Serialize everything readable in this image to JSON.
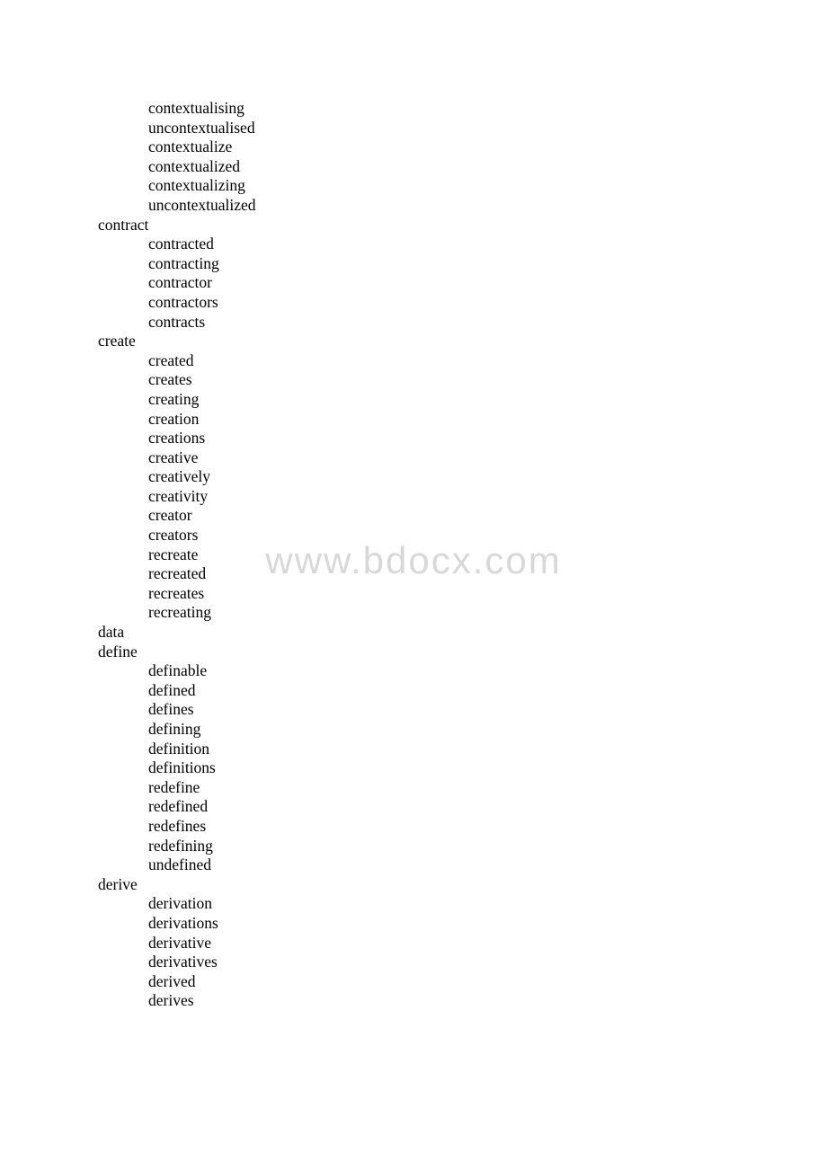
{
  "watermark": "www.bdocx.com",
  "document": {
    "lines": [
      {
        "text": "contextualising",
        "level": 1
      },
      {
        "text": "uncontextualised",
        "level": 1
      },
      {
        "text": "contextualize",
        "level": 1
      },
      {
        "text": "contextualized",
        "level": 1
      },
      {
        "text": "contextualizing",
        "level": 1
      },
      {
        "text": "uncontextualized",
        "level": 1
      },
      {
        "text": "contract",
        "level": 0
      },
      {
        "text": "contracted",
        "level": 1
      },
      {
        "text": "contracting",
        "level": 1
      },
      {
        "text": "contractor",
        "level": 1
      },
      {
        "text": "contractors",
        "level": 1
      },
      {
        "text": "contracts",
        "level": 1
      },
      {
        "text": "create",
        "level": 0
      },
      {
        "text": "created",
        "level": 1
      },
      {
        "text": "creates",
        "level": 1
      },
      {
        "text": "creating",
        "level": 1
      },
      {
        "text": "creation",
        "level": 1
      },
      {
        "text": "creations",
        "level": 1
      },
      {
        "text": "creative",
        "level": 1
      },
      {
        "text": "creatively",
        "level": 1
      },
      {
        "text": "creativity",
        "level": 1
      },
      {
        "text": "creator",
        "level": 1
      },
      {
        "text": "creators",
        "level": 1
      },
      {
        "text": "recreate",
        "level": 1
      },
      {
        "text": "recreated",
        "level": 1
      },
      {
        "text": "recreates",
        "level": 1
      },
      {
        "text": "recreating",
        "level": 1
      },
      {
        "text": "data",
        "level": 0
      },
      {
        "text": "define",
        "level": 0
      },
      {
        "text": "definable",
        "level": 1
      },
      {
        "text": "defined",
        "level": 1
      },
      {
        "text": "defines",
        "level": 1
      },
      {
        "text": "defining",
        "level": 1
      },
      {
        "text": "definition",
        "level": 1
      },
      {
        "text": "definitions",
        "level": 1
      },
      {
        "text": "redefine",
        "level": 1
      },
      {
        "text": "redefined",
        "level": 1
      },
      {
        "text": "redefines",
        "level": 1
      },
      {
        "text": "redefining",
        "level": 1
      },
      {
        "text": "undefined",
        "level": 1
      },
      {
        "text": "derive",
        "level": 0
      },
      {
        "text": "derivation",
        "level": 1
      },
      {
        "text": "derivations",
        "level": 1
      },
      {
        "text": "derivative",
        "level": 1
      },
      {
        "text": "derivatives",
        "level": 1
      },
      {
        "text": "derived",
        "level": 1
      },
      {
        "text": "derives",
        "level": 1
      }
    ]
  }
}
